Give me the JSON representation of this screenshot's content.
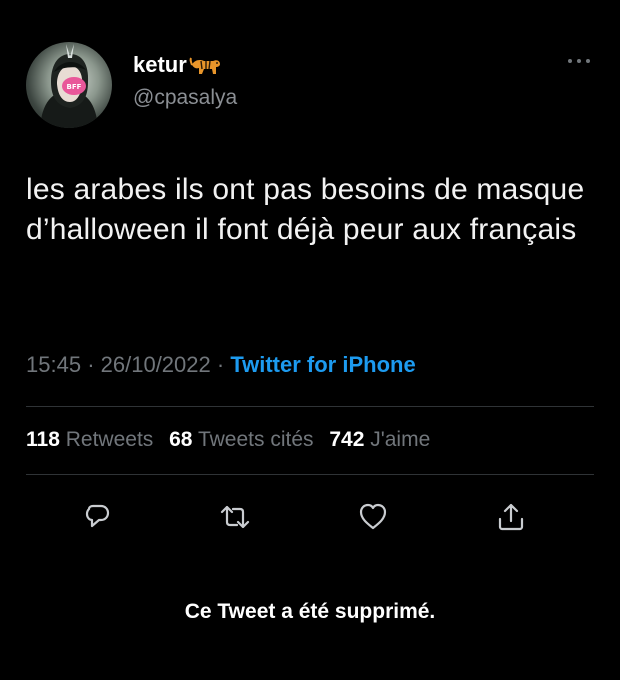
{
  "author": {
    "display_name": "ketur",
    "handle": "@cpasalya",
    "name_emoji": "tiger-icon",
    "avatar_badge": "BFF"
  },
  "tweet": {
    "text": "les arabes ils ont pas besoins de masque d’halloween il font déjà peur aux français"
  },
  "meta": {
    "time": "15:45",
    "separator": "·",
    "date": "26/10/2022",
    "source": "Twitter for iPhone"
  },
  "stats": {
    "retweets_count": "118",
    "retweets_label": "Retweets",
    "quotes_count": "68",
    "quotes_label": "Tweets cités",
    "likes_count": "742",
    "likes_label": "J'aime"
  },
  "actions": {
    "icons": [
      "reply-icon",
      "retweet-icon",
      "like-icon",
      "share-icon"
    ]
  },
  "notice": {
    "deleted": "Ce Tweet a été supprimé."
  },
  "colors": {
    "background": "#000000",
    "text": "#e7e9ea",
    "muted": "#71767b",
    "link": "#1d9bf0",
    "divider": "#2f3336"
  }
}
